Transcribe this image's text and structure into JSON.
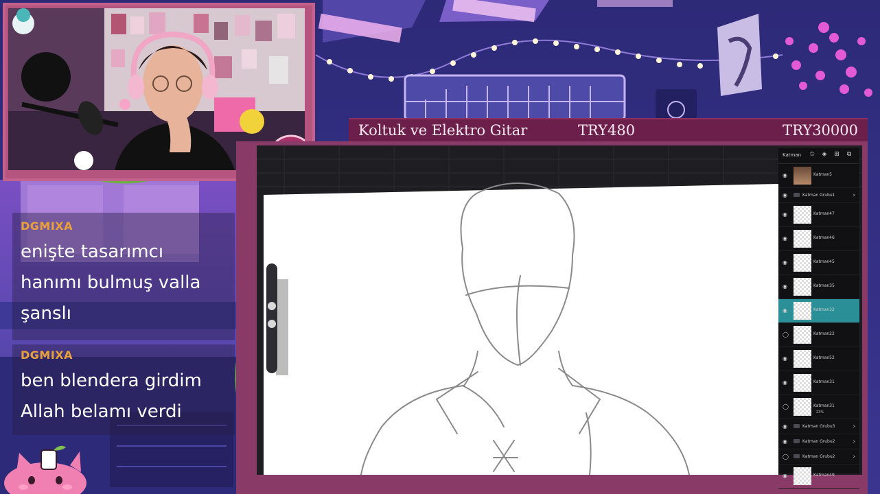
{
  "goal": {
    "name": "Koltuk ve Elektro Gitar",
    "current": "TRY480",
    "target": "TRY30000"
  },
  "chat": {
    "messages": [
      {
        "user": "DGMIXA",
        "lines": [
          "enişte tasarımcı",
          "hanımı bulmuş valla",
          "şanslı"
        ]
      },
      {
        "user": "DGMIXA",
        "lines": [
          "ben blendera girdim",
          "Allah belamı verdi"
        ]
      }
    ]
  },
  "layers_panel": {
    "title": "Katman",
    "header_icons": [
      "pin-icon",
      "stack-icon",
      "add-layer-icon",
      "duplicate-icon"
    ],
    "items": [
      {
        "name": "Katman5",
        "type": "layer",
        "thumbnail": "photo",
        "visible": true
      },
      {
        "name": "Katman Grubu1",
        "type": "group",
        "visible": true
      },
      {
        "name": "Katman47",
        "type": "layer",
        "visible": true
      },
      {
        "name": "Katman46",
        "type": "layer",
        "visible": true
      },
      {
        "name": "Katman45",
        "type": "layer",
        "visible": true
      },
      {
        "name": "Katman35",
        "type": "layer",
        "visible": true
      },
      {
        "name": "Katman32",
        "type": "layer",
        "visible": true,
        "active": true
      },
      {
        "name": "Katman22",
        "type": "layer",
        "visible": false
      },
      {
        "name": "Katman52",
        "type": "layer",
        "visible": true
      },
      {
        "name": "Katman31",
        "type": "layer",
        "visible": true
      },
      {
        "name": "Katman31",
        "type": "layer",
        "visible": false,
        "opacity": "23%"
      },
      {
        "name": "Katman Grubu3",
        "type": "group",
        "visible": true
      },
      {
        "name": "Katman Grubu2",
        "type": "group",
        "visible": true
      },
      {
        "name": "Katman Grubu2",
        "type": "group",
        "visible": false
      },
      {
        "name": "Katman49",
        "type": "layer",
        "visible": true
      }
    ]
  },
  "colors": {
    "frame": "#b5557f",
    "goal_bar": "#6c1f4a",
    "chat_user": "#e9a13a",
    "active_layer": "#2a8f97",
    "scene_bg": "#2a2460"
  }
}
